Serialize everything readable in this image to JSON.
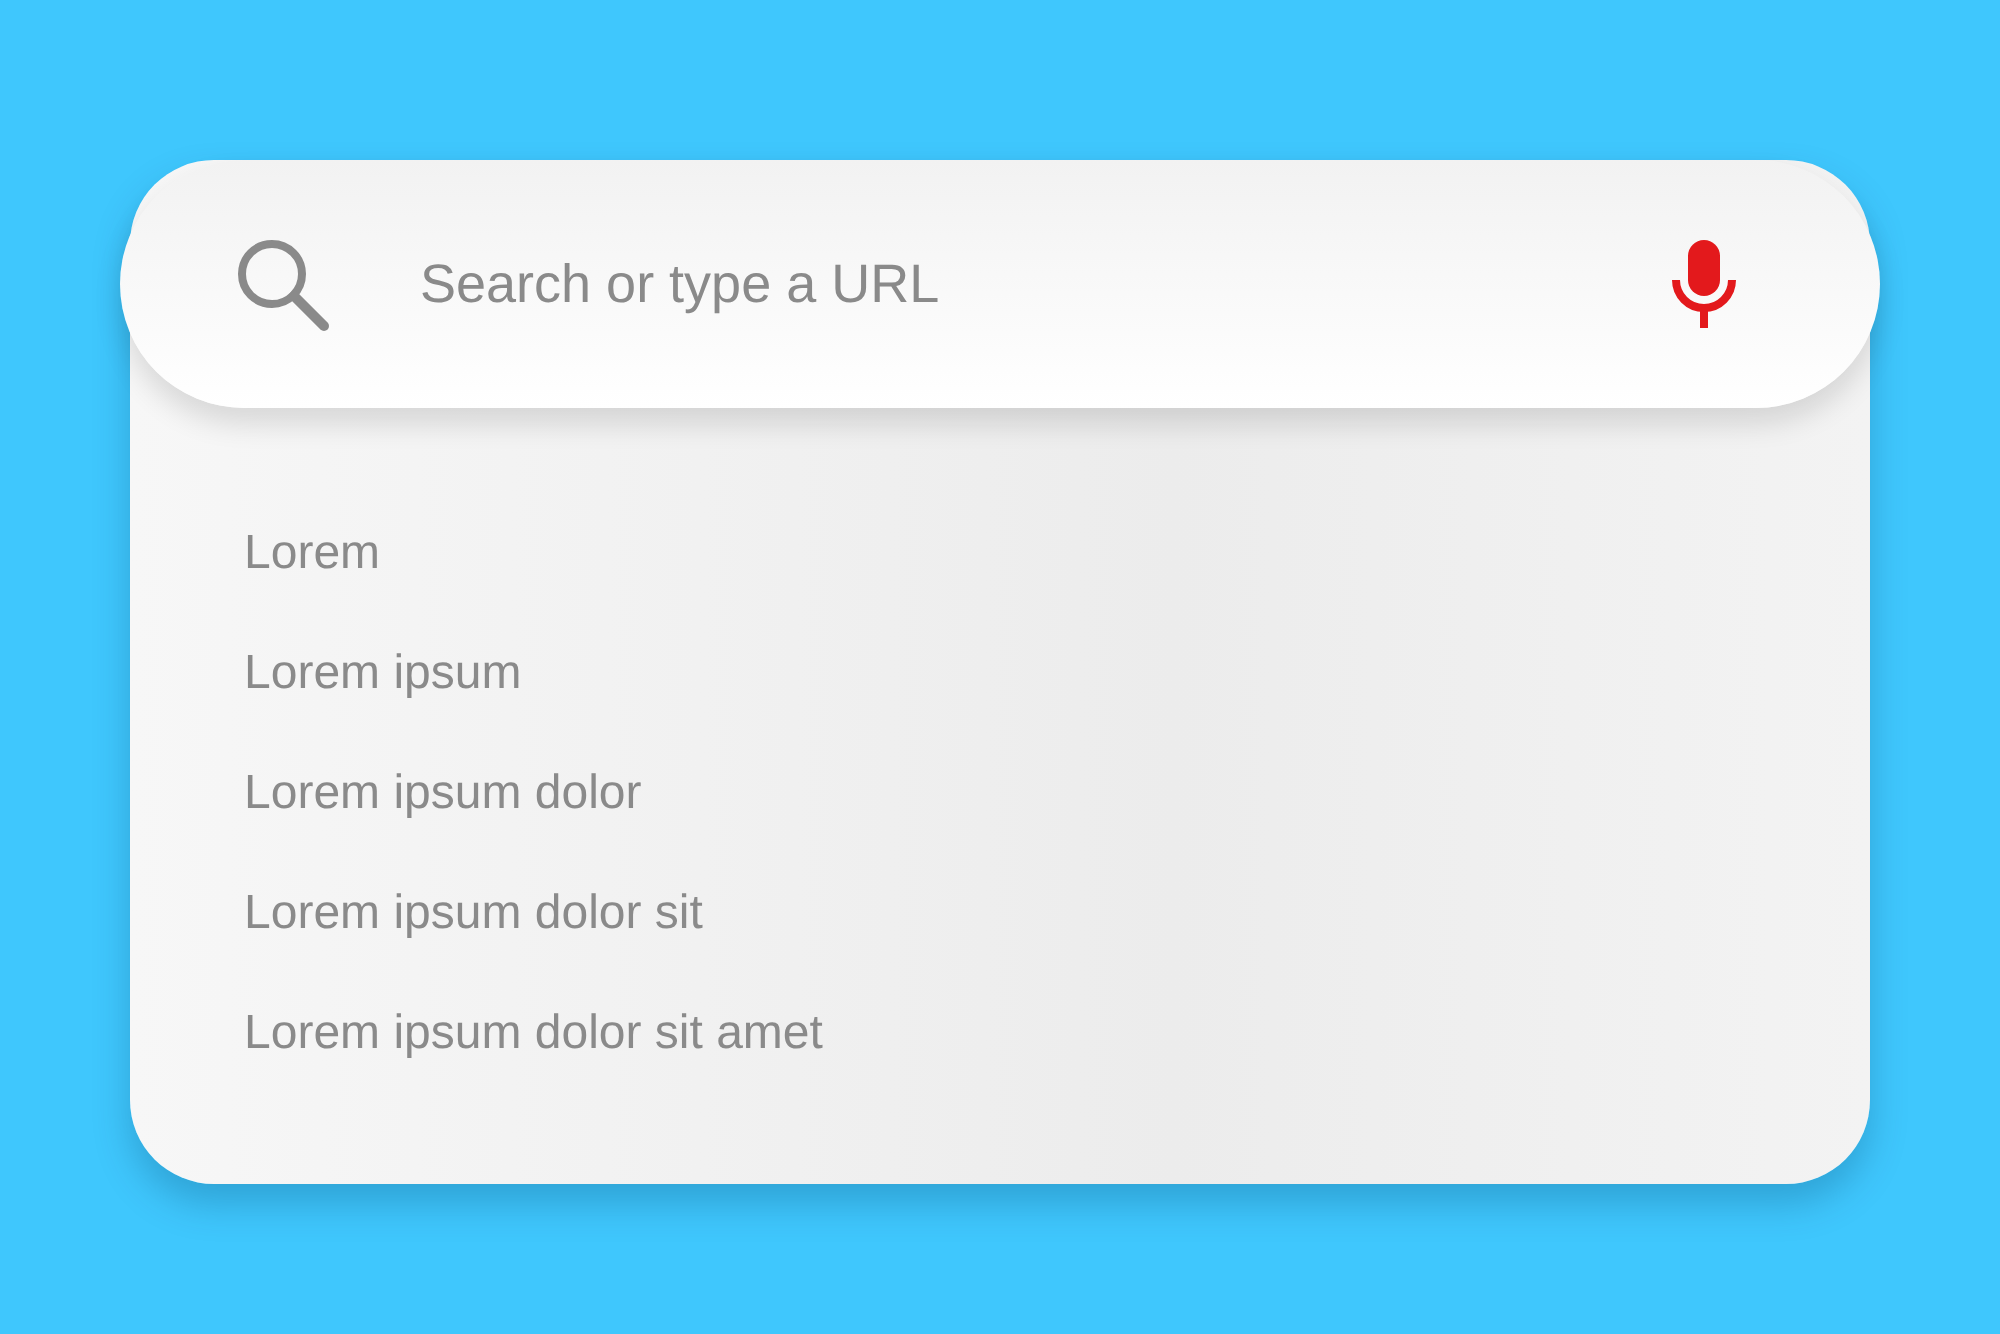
{
  "search": {
    "placeholder": "Search or type a URL"
  },
  "suggestions": [
    "Lorem",
    "Lorem ipsum",
    "Lorem ipsum dolor",
    "Lorem ipsum dolor sit",
    "Lorem ipsum dolor sit amet"
  ]
}
